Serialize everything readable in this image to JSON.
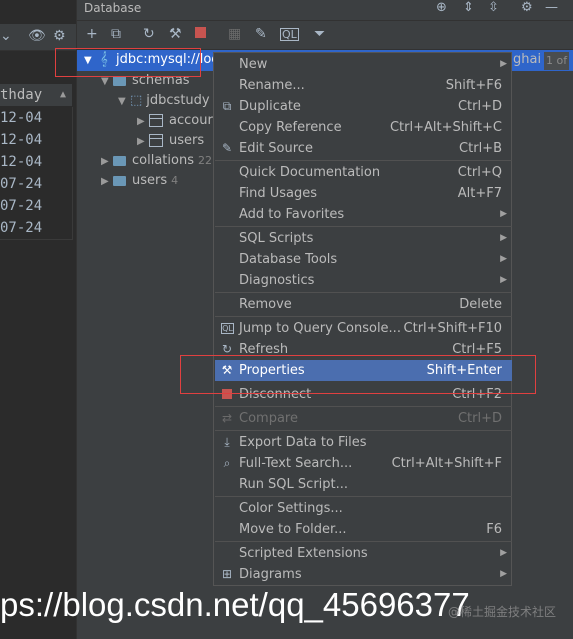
{
  "left_grid": {
    "column_header": "thday",
    "rows": [
      "12-04",
      "12-04",
      "12-04",
      "07-24",
      "07-24",
      "07-24"
    ]
  },
  "db_panel": {
    "title": "Database"
  },
  "tree": {
    "connection": "jdbc:mysql://loc",
    "connection_right": "ghai",
    "pager": "1 of",
    "schemas": "schemas",
    "schema_name": "jdbcstudy",
    "table_account": "accour",
    "table_users": "users",
    "collations": "collations",
    "collations_count": "22",
    "users": "users",
    "users_count": "4"
  },
  "menu": {
    "items": [
      {
        "label": "New",
        "shortcut": "",
        "submenu": true
      },
      {
        "label": "Rename...",
        "shortcut": "Shift+F6",
        "submenu": false
      },
      {
        "label": "Duplicate",
        "shortcut": "Ctrl+D",
        "submenu": false
      },
      {
        "label": "Copy Reference",
        "shortcut": "Ctrl+Alt+Shift+C",
        "submenu": false
      },
      {
        "label": "Edit Source",
        "shortcut": "Ctrl+B",
        "submenu": false
      },
      {
        "label": "Quick Documentation",
        "shortcut": "Ctrl+Q",
        "submenu": false
      },
      {
        "label": "Find Usages",
        "shortcut": "Alt+F7",
        "submenu": false
      },
      {
        "label": "Add to Favorites",
        "shortcut": "",
        "submenu": true
      },
      {
        "label": "SQL Scripts",
        "shortcut": "",
        "submenu": true
      },
      {
        "label": "Database Tools",
        "shortcut": "",
        "submenu": true
      },
      {
        "label": "Diagnostics",
        "shortcut": "",
        "submenu": true
      },
      {
        "label": "Remove",
        "shortcut": "Delete",
        "submenu": false
      },
      {
        "label": "Jump to Query Console...",
        "shortcut": "Ctrl+Shift+F10",
        "submenu": false
      },
      {
        "label": "Refresh",
        "shortcut": "Ctrl+F5",
        "submenu": false
      },
      {
        "label": "Properties",
        "shortcut": "Shift+Enter",
        "submenu": false
      },
      {
        "label": "Disconnect",
        "shortcut": "Ctrl+F2",
        "submenu": false
      },
      {
        "label": "Compare",
        "shortcut": "Ctrl+D",
        "submenu": false
      },
      {
        "label": "Export Data to Files",
        "shortcut": "",
        "submenu": false
      },
      {
        "label": "Full-Text Search...",
        "shortcut": "Ctrl+Alt+Shift+F",
        "submenu": false
      },
      {
        "label": "Run SQL Script...",
        "shortcut": "",
        "submenu": false
      },
      {
        "label": "Color Settings...",
        "shortcut": "",
        "submenu": false
      },
      {
        "label": "Move to Folder...",
        "shortcut": "F6",
        "submenu": false
      },
      {
        "label": "Scripted Extensions",
        "shortcut": "",
        "submenu": true
      },
      {
        "label": "Diagrams",
        "shortcut": "",
        "submenu": true
      }
    ]
  },
  "watermark": {
    "url": "ps://blog.csdn.net/qq_45696377",
    "small": "@稀土掘金技术社区"
  },
  "colors": {
    "selection": "#4b6eaf",
    "highlight_box": "#e04040",
    "panel_bg": "#3c3f41"
  }
}
